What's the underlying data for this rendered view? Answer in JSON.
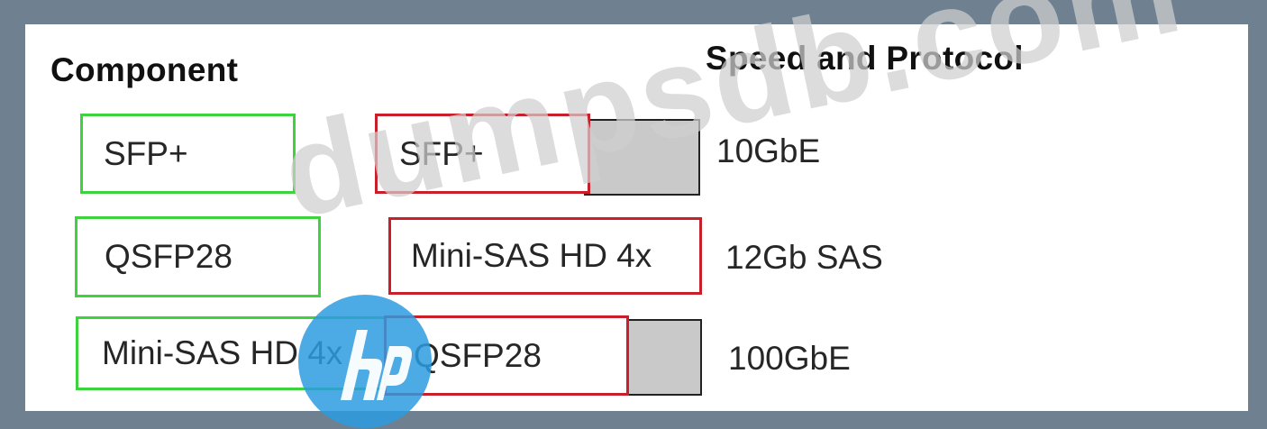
{
  "headings": {
    "component": "Component",
    "speed_protocol": "Speed and Protocol"
  },
  "components": [
    "SFP+",
    "QSFP28",
    "Mini-SAS HD 4x"
  ],
  "targets": [
    {
      "component": "SFP+",
      "speed": "10GbE"
    },
    {
      "component": "Mini-SAS HD 4x",
      "speed": "12Gb SAS"
    },
    {
      "component": "QSFP28",
      "speed": "100GbE"
    }
  ],
  "watermark": "dumpsdb.com",
  "logo": {
    "text": "hp",
    "color": "#2d9be0",
    "icon": "hp-logo-icon"
  },
  "colors": {
    "source_border": "#3ed23e",
    "placed_border": "#c8202a",
    "slot_fill": "#c9c9c9",
    "frame": "#6f8191"
  }
}
